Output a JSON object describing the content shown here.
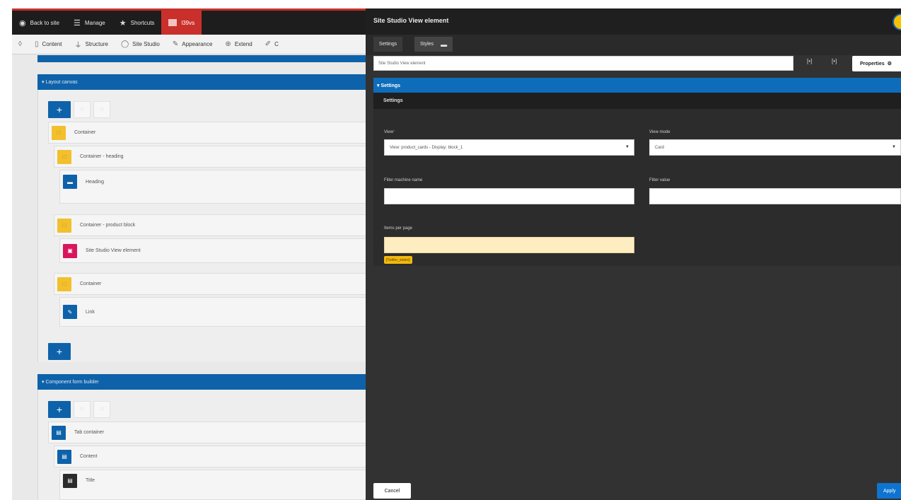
{
  "toolbar": {
    "items": [
      {
        "label": "Back to site",
        "icon": "drupal-drop-icon"
      },
      {
        "label": "Manage",
        "icon": "menu-icon"
      },
      {
        "label": "Shortcuts",
        "icon": "star-icon"
      },
      {
        "label": "l39vs",
        "icon": "user-icon"
      }
    ]
  },
  "admin_menu": {
    "items": [
      {
        "label": "Content",
        "icon": "page-icon"
      },
      {
        "label": "Structure",
        "icon": "structure-icon"
      },
      {
        "label": "Site Studio",
        "icon": "site-studio-icon"
      },
      {
        "label": "Appearance",
        "icon": "brush-icon"
      },
      {
        "label": "Extend",
        "icon": "puzzle-icon"
      },
      {
        "label": "C",
        "icon": "wrench-icon"
      }
    ]
  },
  "layout_canvas": {
    "title": "▾ Layout canvas",
    "rows": [
      {
        "label": "Container",
        "color": "#f2bf2d"
      },
      {
        "label": "Container - heading",
        "color": "#f2bf2d"
      },
      {
        "label": "Heading",
        "color": "#0e62a9"
      },
      {
        "label": "Container - product block",
        "color": "#f2bf2d"
      },
      {
        "label": "Site Studio View element",
        "color": "#d9155d"
      },
      {
        "label": "Container",
        "color": "#f2bf2d"
      },
      {
        "label": "Link",
        "color": "#0e62a9"
      }
    ]
  },
  "component_form_builder": {
    "title": "▾ Component form builder",
    "rows": [
      {
        "label": "Tab container"
      },
      {
        "label": "Content"
      },
      {
        "label": "Title"
      }
    ]
  },
  "modal": {
    "title": "Site Studio View element",
    "tabs": [
      "Settings",
      "Styles"
    ],
    "name_value": "Site Studio View element",
    "properties_label": "Properties",
    "settings_section": "▾ Settings",
    "settings_subhead": "Settings",
    "fields": {
      "view_label": "View",
      "view_required": "*",
      "view_value": "View: product_cards - Display: block_1",
      "view_mode_label": "View mode",
      "view_mode_value": "Card",
      "filter_machine_label": "Filter machine name",
      "filter_value_label": "Filter value",
      "items_per_page_label": "Items per page",
      "items_per_page_token": "[Twitter_states]"
    },
    "cancel_label": "Cancel",
    "apply_label": "Apply"
  },
  "colors": {
    "drupal_blue": "#0e62a9",
    "modal_bg": "#323232",
    "toolbar_red": "#c9302b",
    "token_yellow": "#f2b90d"
  }
}
